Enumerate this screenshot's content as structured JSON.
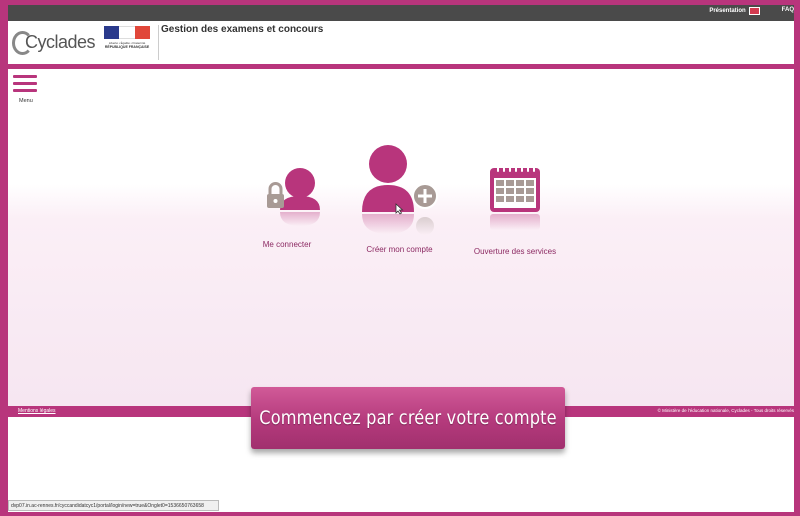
{
  "topbar": {
    "presentation": "Présentation",
    "faq": "FAQ"
  },
  "header": {
    "logo_text": "Cyclades",
    "marianne_motto": "Liberté • Égalité • Fraternité",
    "marianne_rep": "RÉPUBLIQUE FRANÇAISE",
    "title": "Gestion des examens et concours"
  },
  "menu": {
    "label": "Menu"
  },
  "tiles": [
    {
      "label": "Me connecter",
      "icon": "user-lock-icon"
    },
    {
      "label": "Créer mon compte",
      "icon": "user-add-icon"
    },
    {
      "label": "Ouverture des services",
      "icon": "calendar-icon"
    }
  ],
  "footer": {
    "legal": "Mentions légales",
    "copyright": "© Ministère de l'éducation nationale, Cyclades - Tous droits réservés"
  },
  "cta": {
    "label": "Commencez par créer votre compte"
  },
  "status_url": "dvp07.in.ac-rennes.fr/cyccandidatcyc1/portal/login/new=true&Onglet0=1536650763658",
  "colors": {
    "accent": "#b8357c",
    "icon_grey": "#a89a95"
  }
}
